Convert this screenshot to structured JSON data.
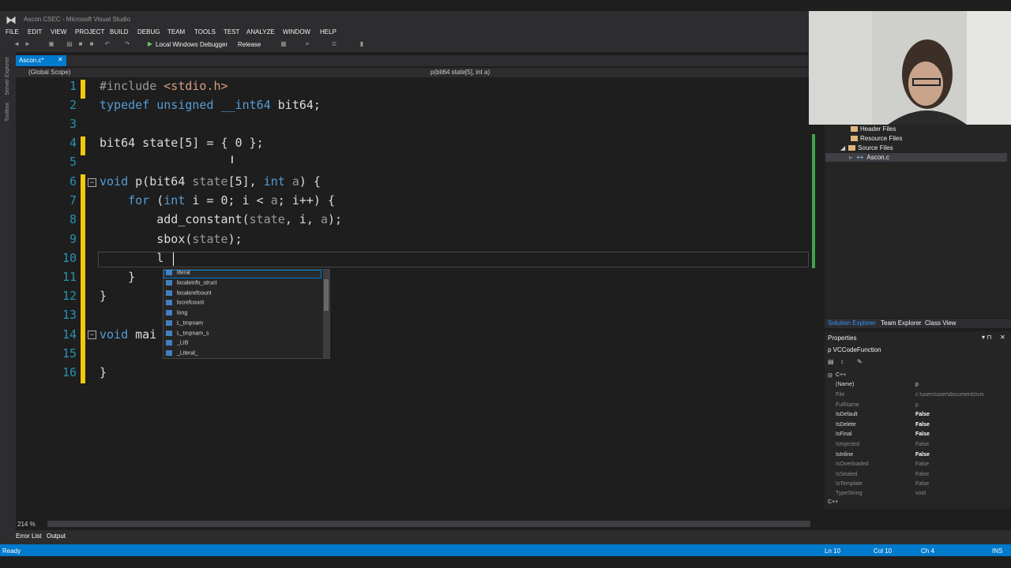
{
  "window": {
    "title": "Ascon CSEC - Microsoft Visual Studio"
  },
  "menu": [
    "FILE",
    "EDIT",
    "VIEW",
    "PROJECT",
    "BUILD",
    "DEBUG",
    "TEAM",
    "TOOLS",
    "TEST",
    "ANALYZE",
    "WINDOW",
    "HELP"
  ],
  "toolbar": {
    "debugger": "Local Windows Debugger",
    "config": "Release"
  },
  "side_tabs": [
    "Server Explorer",
    "Toolbox"
  ],
  "tab": {
    "label": "Ascon.c*"
  },
  "nav": {
    "scope_left": "(Global Scope)",
    "scope_right": "p(bit64 state[5], int a)"
  },
  "code": {
    "line_numbers": [
      "1",
      "2",
      "3",
      "4",
      "5",
      "6",
      "7",
      "8",
      "9",
      "10",
      "11",
      "12",
      "13",
      "14",
      "15",
      "16"
    ]
  },
  "intellisense": [
    "literal",
    "localeinfo_struct",
    "localerefcount",
    "locrefcount",
    "long",
    "L_tmpnam",
    "L_tmpnam_s",
    "_LIB",
    "_Literal_"
  ],
  "editor": {
    "zoom": "214 %"
  },
  "solution_explorer": {
    "items": [
      "Header Files",
      "Resource Files",
      "Source Files",
      "Ascon.c"
    ],
    "tabs": [
      "Solution Explorer",
      "Team Explorer",
      "Class View"
    ]
  },
  "properties": {
    "title": "Properties",
    "object": "p VCCodeFunction",
    "category": "C++",
    "rows": [
      {
        "name": "(Name)",
        "value": "p"
      },
      {
        "name": "File",
        "value": "c:\\users\\user\\documents\\vis"
      },
      {
        "name": "FullName",
        "value": "p"
      },
      {
        "name": "IsDefault",
        "value": "False"
      },
      {
        "name": "IsDelete",
        "value": "False"
      },
      {
        "name": "IsFinal",
        "value": "False"
      },
      {
        "name": "IsInjected",
        "value": "False"
      },
      {
        "name": "IsInline",
        "value": "False"
      },
      {
        "name": "IsOverloaded",
        "value": "False"
      },
      {
        "name": "IsSealed",
        "value": "False"
      },
      {
        "name": "IsTemplate",
        "value": "False"
      },
      {
        "name": "TypeString",
        "value": "void"
      }
    ],
    "footer": "C++"
  },
  "bottom_tabs": [
    "Error List",
    "Output"
  ],
  "status": {
    "left": "Ready",
    "ln": "Ln 10",
    "col": "Col 10",
    "ch": "Ch 4",
    "mode": "INS"
  }
}
